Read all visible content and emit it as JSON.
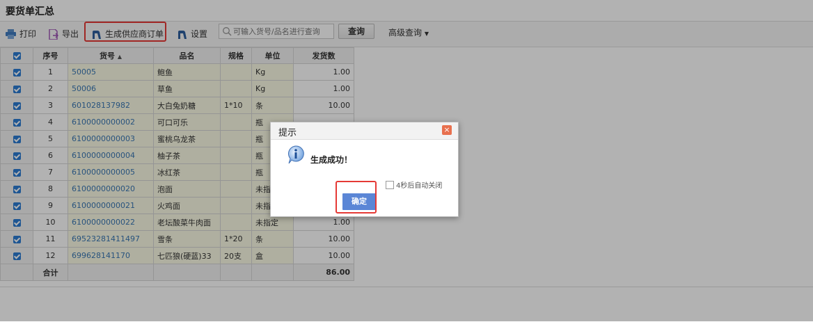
{
  "page": {
    "title": "要货单汇总"
  },
  "toolbar": {
    "print_label": "打印",
    "export_label": "导出",
    "generate_label": "生成供应商订单",
    "settings_label": "设置",
    "search_placeholder": "可输入货号/品名进行查询",
    "search_button": "查询",
    "advanced_label": "高级查询"
  },
  "table": {
    "headers": {
      "seq": "序号",
      "code": "货号",
      "name": "品名",
      "spec": "规格",
      "unit": "单位",
      "qty": "发货数"
    },
    "rows": [
      {
        "no": "1",
        "code": "50005",
        "name": "鲍鱼",
        "spec": "",
        "unit": "Kg",
        "qty": "1.00"
      },
      {
        "no": "2",
        "code": "50006",
        "name": "草鱼",
        "spec": "",
        "unit": "Kg",
        "qty": "1.00"
      },
      {
        "no": "3",
        "code": "601028137982",
        "name": "大白兔奶糖",
        "spec": "1*10",
        "unit": "条",
        "qty": "10.00"
      },
      {
        "no": "4",
        "code": "6100000000002",
        "name": "可口可乐",
        "spec": "",
        "unit": "瓶",
        "qty": ""
      },
      {
        "no": "5",
        "code": "6100000000003",
        "name": "蜜桃乌龙茶",
        "spec": "",
        "unit": "瓶",
        "qty": ""
      },
      {
        "no": "6",
        "code": "6100000000004",
        "name": "柚子茶",
        "spec": "",
        "unit": "瓶",
        "qty": ""
      },
      {
        "no": "7",
        "code": "6100000000005",
        "name": "冰红茶",
        "spec": "",
        "unit": "瓶",
        "qty": ""
      },
      {
        "no": "8",
        "code": "6100000000020",
        "name": "泡面",
        "spec": "",
        "unit": "未指",
        "qty": ""
      },
      {
        "no": "9",
        "code": "6100000000021",
        "name": "火鸡面",
        "spec": "",
        "unit": "未指",
        "qty": ""
      },
      {
        "no": "10",
        "code": "6100000000022",
        "name": "老坛酸菜牛肉面",
        "spec": "",
        "unit": "未指定",
        "qty": "1.00"
      },
      {
        "no": "11",
        "code": "69523281411497",
        "name": "雪条",
        "spec": "1*20",
        "unit": "条",
        "qty": "10.00"
      },
      {
        "no": "12",
        "code": "699628141170",
        "name": "七匹狼(硬蓝)33",
        "spec": "20支",
        "unit": "盒",
        "qty": "10.00"
      }
    ],
    "total_label": "合计",
    "total_qty": "86.00"
  },
  "dialog": {
    "title": "提示",
    "close_glyph": "×",
    "message": "生成成功！",
    "auto_close_label": "4秒后自动关闭",
    "ok_label": "确定"
  },
  "colors": {
    "accent": "#2b7cd3",
    "highlight_box": "#e53935",
    "ok_button": "#5b86d6",
    "cell_bg": "#fbfbe6"
  }
}
